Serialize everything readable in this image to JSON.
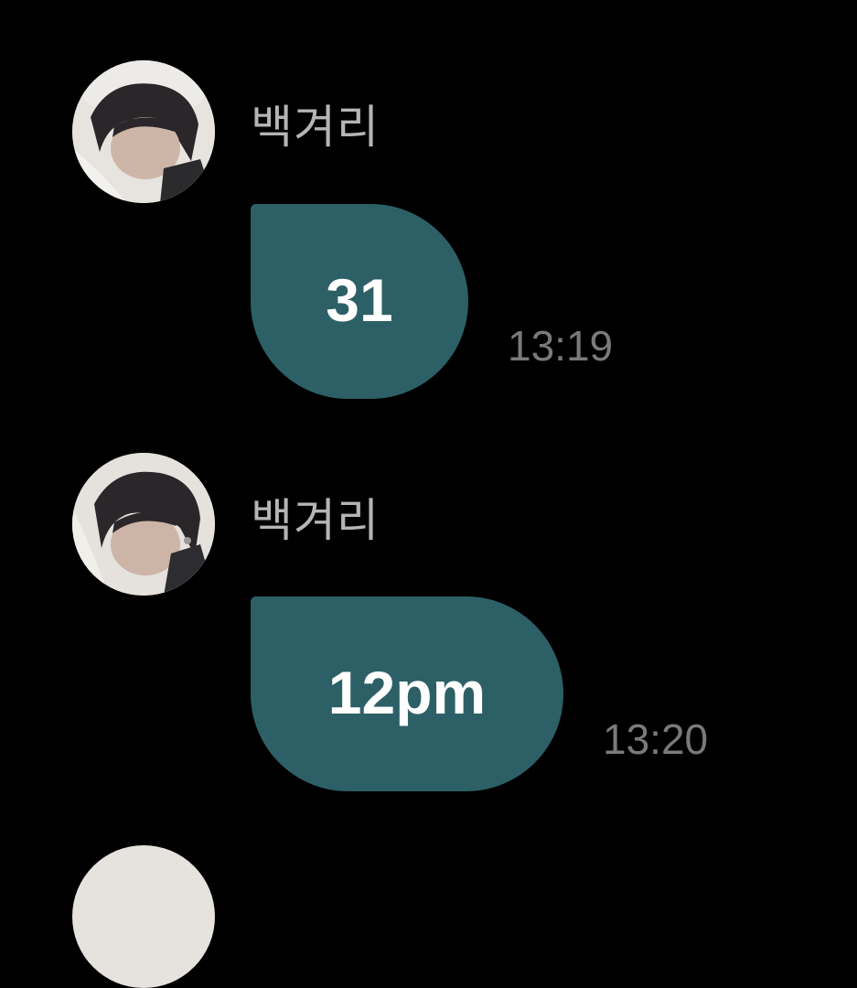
{
  "messages": [
    {
      "sender": "백겨리",
      "text": "31",
      "time": "13:19"
    },
    {
      "sender": "백겨리",
      "text": "12pm",
      "time": "13:20"
    }
  ],
  "colors": {
    "background": "#000000",
    "bubble": "#2c6066",
    "bubble_text": "#ffffff",
    "sender_text": "#b5b5b5",
    "time_text": "#7a7a7a"
  }
}
